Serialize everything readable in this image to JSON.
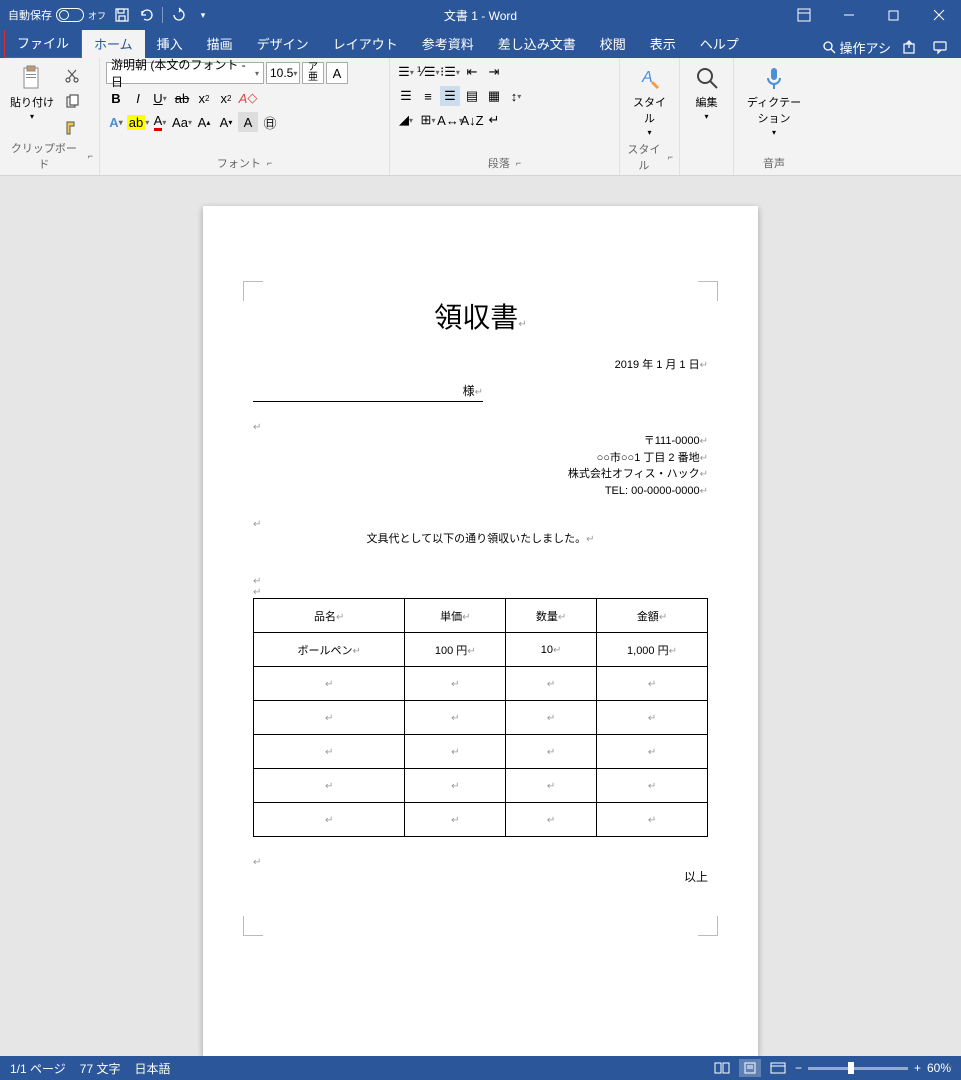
{
  "titlebar": {
    "autosave_label": "自動保存",
    "autosave_state": "オフ",
    "title": "文書 1  -  Word"
  },
  "tabs": {
    "file": "ファイル",
    "home": "ホーム",
    "insert": "挿入",
    "draw": "描画",
    "design": "デザイン",
    "layout": "レイアウト",
    "references": "参考資料",
    "mailings": "差し込み文書",
    "review": "校閲",
    "view": "表示",
    "help": "ヘルプ",
    "search": "操作アシ"
  },
  "ribbon": {
    "clipboard": {
      "paste": "貼り付け",
      "label": "クリップボード"
    },
    "font": {
      "name": "游明朝 (本文のフォント - 日",
      "size": "10.5",
      "label": "フォント"
    },
    "paragraph": {
      "label": "段落"
    },
    "styles": {
      "name": "スタイル",
      "label": "スタイル"
    },
    "editing": {
      "name": "編集",
      "label": ""
    },
    "dictate": {
      "name": "ディクテーション",
      "label": "音声"
    }
  },
  "document": {
    "title": "領収書",
    "date": "2019 年 1 月 1 日",
    "recipient_suffix": "様",
    "sender": {
      "postal": "〒111-0000",
      "address": "○○市○○1 丁目 2 番地",
      "company": "株式会社オフィス・ハック",
      "tel": "TEL: 00-0000-0000"
    },
    "intro": "文具代として以下の通り領収いたしました。",
    "table": {
      "headers": [
        "品名",
        "単価",
        "数量",
        "金額"
      ],
      "rows": [
        [
          "ボールペン",
          "100 円",
          "10",
          "1,000 円"
        ],
        [
          "",
          "",
          "",
          ""
        ],
        [
          "",
          "",
          "",
          ""
        ],
        [
          "",
          "",
          "",
          ""
        ],
        [
          "",
          "",
          "",
          ""
        ],
        [
          "",
          "",
          "",
          ""
        ]
      ]
    },
    "closing": "以上"
  },
  "statusbar": {
    "page": "1/1 ページ",
    "words": "77 文字",
    "lang": "日本語",
    "zoom": "60%"
  }
}
